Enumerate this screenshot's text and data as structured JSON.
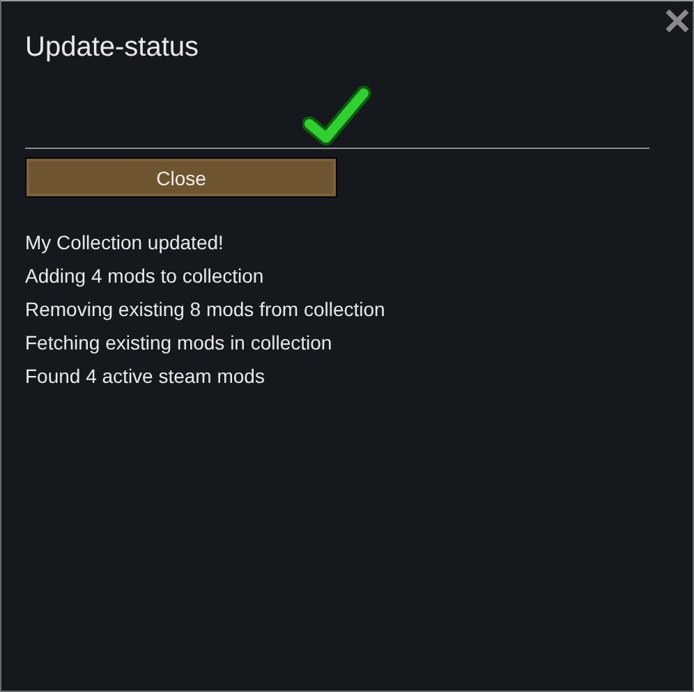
{
  "dialog": {
    "title": "Update-status",
    "succeeded": true,
    "button": "Close",
    "log": [
      "My Collection updated!",
      "Adding 4 mods to collection",
      "Removing existing 8 mods from collection",
      "Fetching existing mods in collection",
      "Found 4 active steam mods"
    ]
  }
}
